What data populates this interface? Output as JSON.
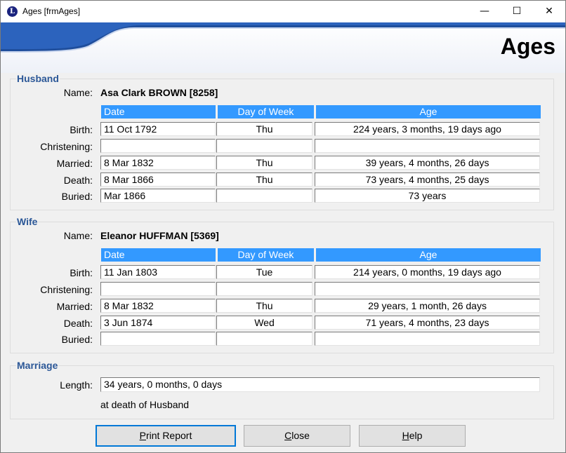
{
  "window": {
    "title": "Ages [frmAges]",
    "icon_letter": "L",
    "minimize_glyph": "—",
    "maximize_glyph": "☐",
    "close_glyph": "✕"
  },
  "banner": {
    "title": "Ages"
  },
  "labels": {
    "name": "Name:",
    "birth": "Birth:",
    "christening": "Christening:",
    "married": "Married:",
    "death": "Death:",
    "buried": "Buried:",
    "length": "Length:"
  },
  "columns": {
    "date": "Date",
    "day_of_week": "Day of Week",
    "age": "Age"
  },
  "husband": {
    "legend": "Husband",
    "name": "Asa Clark BROWN [8258]",
    "events": [
      {
        "label_key": "birth",
        "date": "11 Oct 1792",
        "dow": "Thu",
        "age": "224 years, 3 months, 19 days ago"
      },
      {
        "label_key": "christening",
        "date": "",
        "dow": "",
        "age": ""
      },
      {
        "label_key": "married",
        "date": "8 Mar 1832",
        "dow": "Thu",
        "age": "39 years, 4 months, 26 days"
      },
      {
        "label_key": "death",
        "date": "8 Mar 1866",
        "dow": "Thu",
        "age": "73 years, 4 months, 25 days"
      },
      {
        "label_key": "buried",
        "date": "Mar 1866",
        "dow": "",
        "age": "73 years"
      }
    ]
  },
  "wife": {
    "legend": "Wife",
    "name": "Eleanor HUFFMAN [5369]",
    "events": [
      {
        "label_key": "birth",
        "date": "11 Jan 1803",
        "dow": "Tue",
        "age": "214 years, 0 months, 19 days ago"
      },
      {
        "label_key": "christening",
        "date": "",
        "dow": "",
        "age": ""
      },
      {
        "label_key": "married",
        "date": "8 Mar 1832",
        "dow": "Thu",
        "age": "29 years, 1 month, 26 days"
      },
      {
        "label_key": "death",
        "date": "3 Jun 1874",
        "dow": "Wed",
        "age": "71 years, 4 months, 23 days"
      },
      {
        "label_key": "buried",
        "date": "",
        "dow": "",
        "age": ""
      }
    ]
  },
  "marriage": {
    "legend": "Marriage",
    "length": "34 years, 0 months, 0 days",
    "note": "at death of Husband"
  },
  "buttons": {
    "print": {
      "access_key": "P",
      "rest": "rint Report"
    },
    "close": {
      "access_key": "C",
      "rest": "lose"
    },
    "help": {
      "access_key": "H",
      "rest": "elp"
    }
  },
  "colors": {
    "header_bg": "#3399ff",
    "legend_text": "#2b5797",
    "banner_swoosh": "#1f4e9c",
    "focus_border": "#0078d7"
  }
}
